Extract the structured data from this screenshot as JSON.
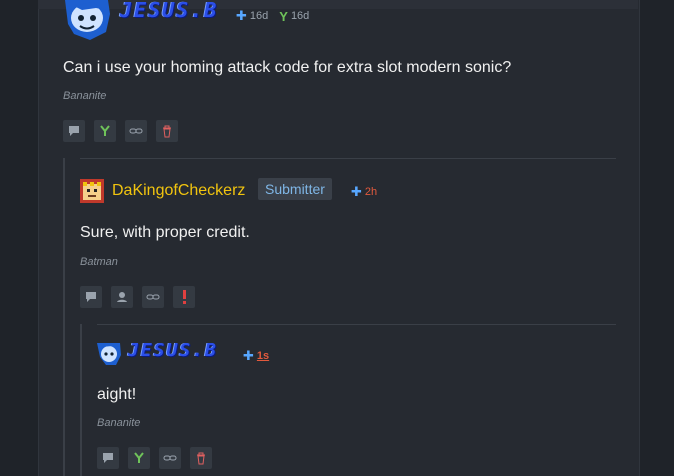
{
  "comments": [
    {
      "author": "JESUS.B",
      "time_submitted": "16d",
      "time_updated": "16d",
      "text": "Can i use your homing attack code for extra slot modern sonic?",
      "signature": "Bananite"
    },
    {
      "author": "DaKingofCheckerz",
      "badge": "Submitter",
      "time": "2h",
      "text": "Sure, with proper credit.",
      "signature": "Batman"
    },
    {
      "author": "JESUS.B",
      "time": "1s",
      "text": "aight!",
      "signature": "Bananite"
    }
  ],
  "icons": {
    "reply": "speech-bubble-icon",
    "y": "y-icon",
    "link": "link-icon",
    "delete": "trash-icon",
    "flag": "flag-icon",
    "user": "user-icon"
  },
  "colors": {
    "background": "#1f2329",
    "panel": "#262a31",
    "accent_blue": "#58a7ff",
    "accent_green": "#6fc35a",
    "gold_name": "#f1c40f",
    "red_time": "#e25a3d"
  }
}
